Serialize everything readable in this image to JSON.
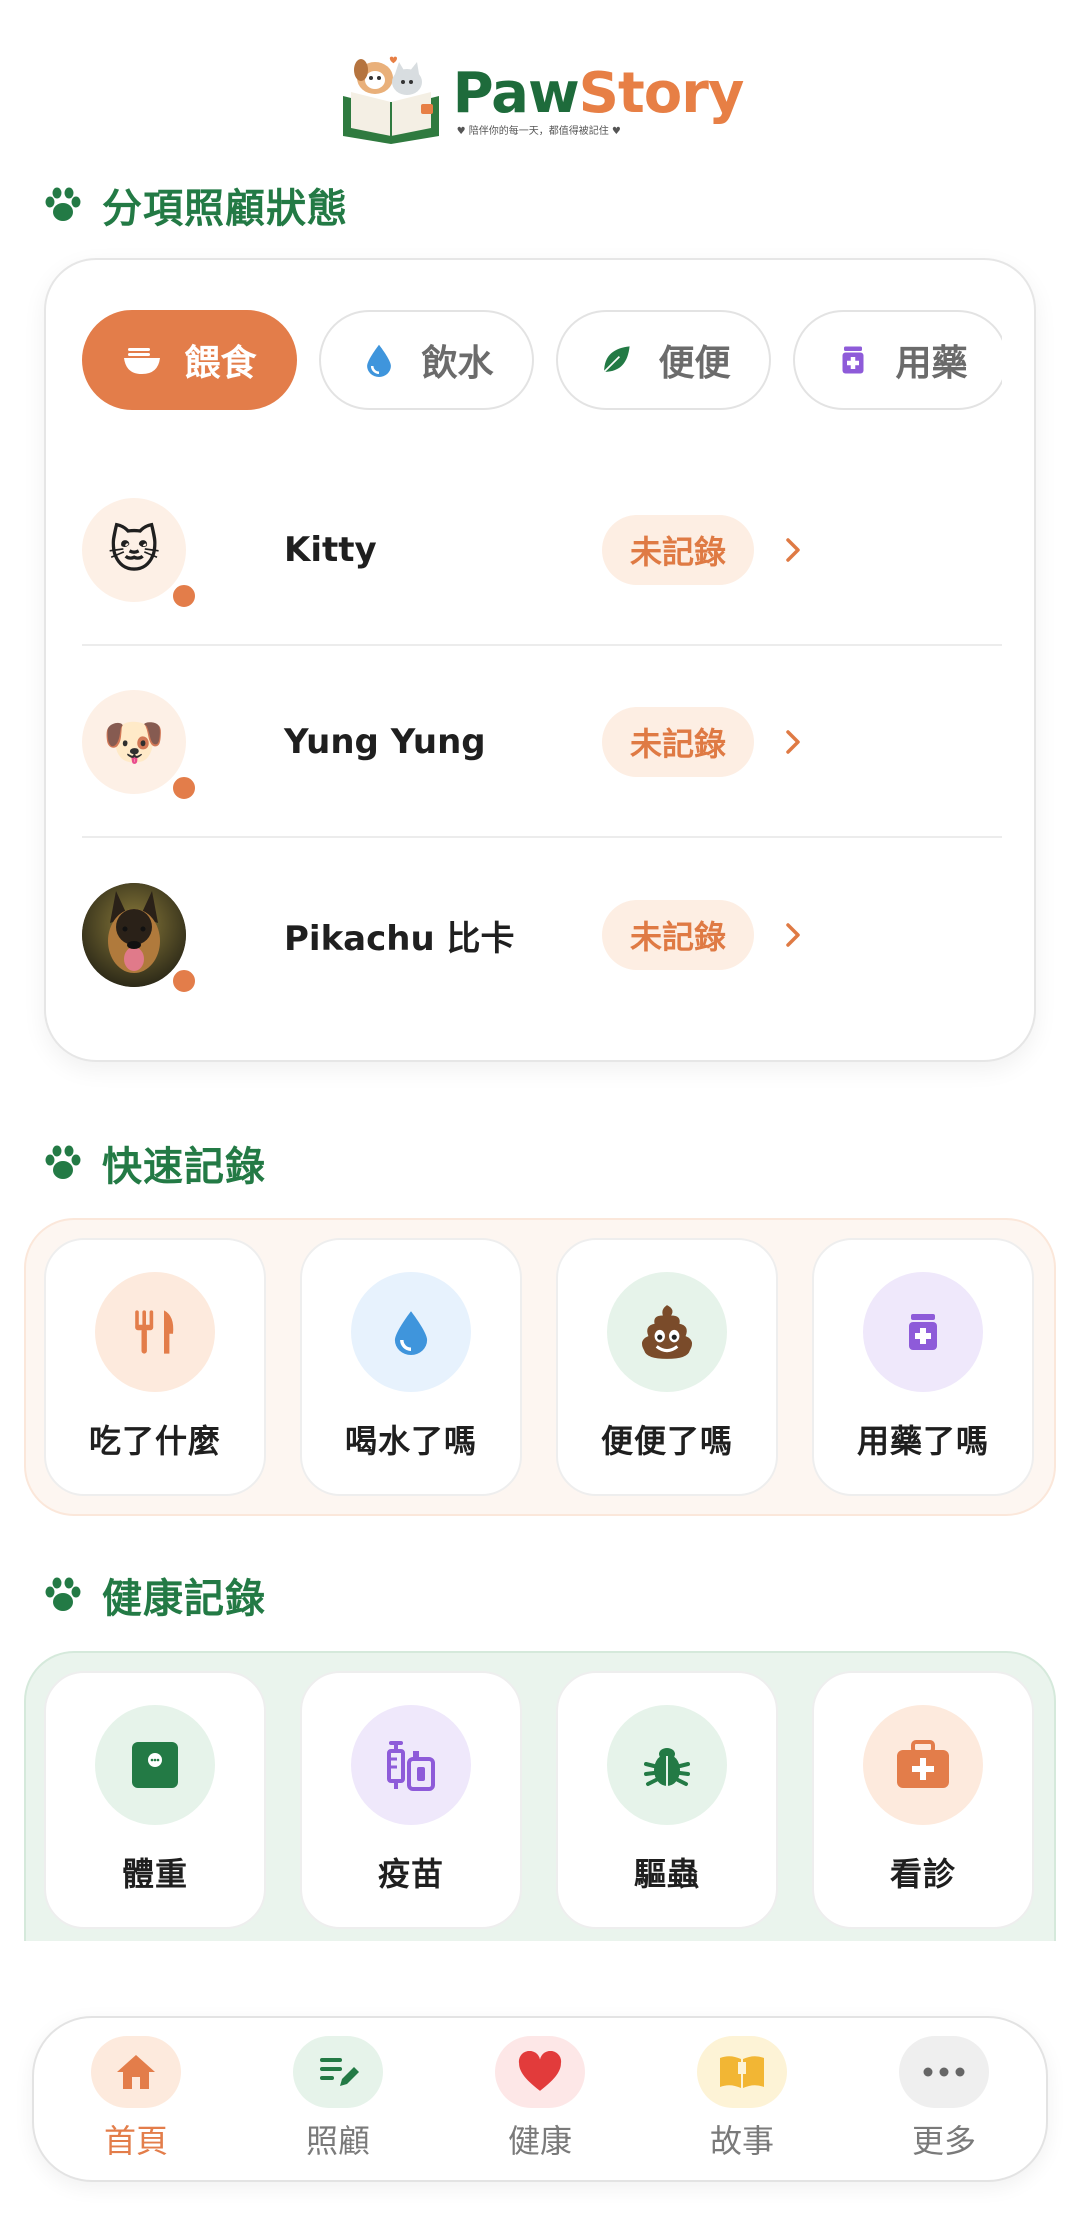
{
  "brand": {
    "name_part1": "Paw",
    "name_part2": "Story",
    "tagline": "♥ 陪伴你的每一天，都值得被記住 ♥"
  },
  "care_status": {
    "title": "分項照顧狀態",
    "tabs": [
      {
        "label": "餵食",
        "icon": "bowl-icon",
        "active": true
      },
      {
        "label": "飲水",
        "icon": "water-drop-icon",
        "active": false
      },
      {
        "label": "便便",
        "icon": "leaf-icon",
        "active": false
      },
      {
        "label": "用藥",
        "icon": "medicine-bottle-icon",
        "active": false
      }
    ],
    "pets": [
      {
        "name": "Kitty",
        "avatar": "🐱",
        "status": "未記錄"
      },
      {
        "name": "Yung Yung",
        "avatar": "🐶",
        "status": "未記錄"
      },
      {
        "name": "Pikachu 比卡",
        "avatar": "photo-german-shepherd",
        "status": "未記錄"
      }
    ]
  },
  "quick_record": {
    "title": "快速記錄",
    "items": [
      {
        "label": "吃了什麼",
        "icon": "fork-knife-icon",
        "color": "#fdeadd"
      },
      {
        "label": "喝水了嗎",
        "icon": "water-drop-icon",
        "color": "#e7f2fd"
      },
      {
        "label": "便便了嗎",
        "icon": "poop-icon",
        "color": "#e6f3ea"
      },
      {
        "label": "用藥了嗎",
        "icon": "medicine-bottle-icon",
        "color": "#efe8fb"
      }
    ]
  },
  "health_record": {
    "title": "健康記錄",
    "items": [
      {
        "label": "體重",
        "icon": "scale-icon",
        "color": "#e6f3ea"
      },
      {
        "label": "疫苗",
        "icon": "vaccine-icon",
        "color": "#efe8fb"
      },
      {
        "label": "驅蟲",
        "icon": "bug-icon",
        "color": "#e6f3ea"
      },
      {
        "label": "看診",
        "icon": "medical-kit-icon",
        "color": "#fdeadd"
      }
    ]
  },
  "nav": {
    "items": [
      {
        "label": "首頁",
        "icon": "home-icon",
        "active": true
      },
      {
        "label": "照顧",
        "icon": "edit-list-icon",
        "active": false
      },
      {
        "label": "健康",
        "icon": "heart-icon",
        "active": false
      },
      {
        "label": "故事",
        "icon": "book-icon",
        "active": false
      },
      {
        "label": "更多",
        "icon": "more-dots-icon",
        "active": false
      }
    ]
  },
  "colors": {
    "brand_green": "#237a45",
    "accent_orange": "#e37d4a",
    "badge_bg": "#fdeee3"
  }
}
